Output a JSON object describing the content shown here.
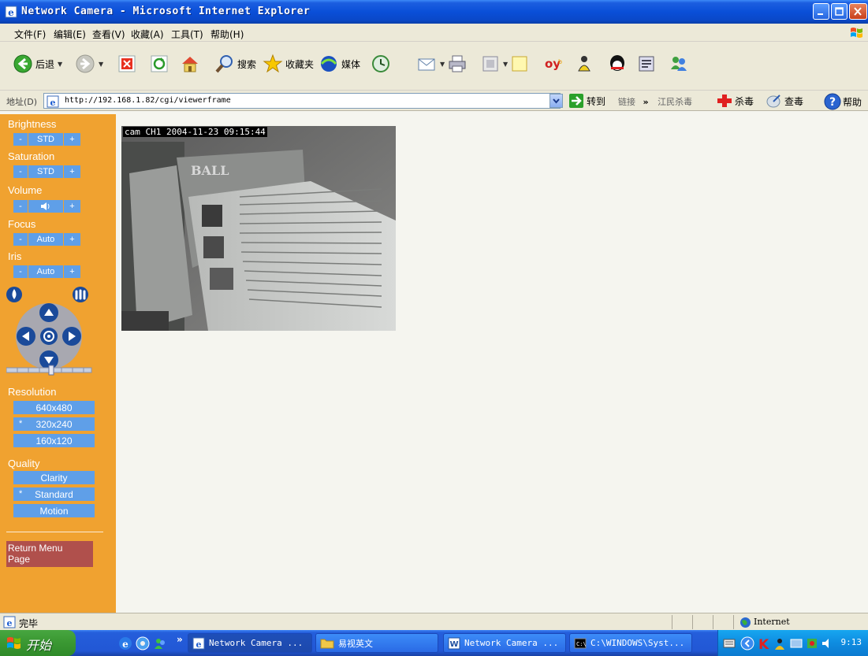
{
  "window": {
    "title": "Network Camera - Microsoft Internet Explorer",
    "colors": {
      "titlebar": "#0a4fd8",
      "panel": "#f0a230",
      "control": "#5f9fe8",
      "return_button": "#b0504c"
    }
  },
  "menu": {
    "items": [
      "文件(F)",
      "编辑(E)",
      "查看(V)",
      "收藏(A)",
      "工具(T)",
      "帮助(H)"
    ]
  },
  "toolbar": {
    "back_label": "后退",
    "search_label": "搜索",
    "favorites_label": "收藏夹",
    "media_label": "媒体"
  },
  "address": {
    "label": "地址(D)",
    "url": "http://192.168.1.82/cgi/viewerframe",
    "go_label": "转到",
    "links_label": "链接",
    "links_extra": "江民杀毒",
    "antivirus_label": "杀毒",
    "scan_label": "查毒",
    "help_label": "帮助"
  },
  "panel": {
    "brightness": {
      "label": "Brightness",
      "minus": "-",
      "value": "STD",
      "plus": "+"
    },
    "saturation": {
      "label": "Saturation",
      "minus": "-",
      "value": "STD",
      "plus": "+"
    },
    "volume": {
      "label": "Volume",
      "minus": "-",
      "value": "🔈",
      "plus": "+"
    },
    "focus": {
      "label": "Focus",
      "minus": "-",
      "value": "Auto",
      "plus": "+"
    },
    "iris": {
      "label": "Iris",
      "minus": "-",
      "value": "Auto",
      "plus": "+"
    },
    "resolution": {
      "label": "Resolution",
      "options": [
        {
          "label": "640x480",
          "selected": false
        },
        {
          "label": "320x240",
          "selected": true
        },
        {
          "label": "160x120",
          "selected": false
        }
      ]
    },
    "quality": {
      "label": "Quality",
      "options": [
        {
          "label": "Clarity",
          "selected": false
        },
        {
          "label": "Standard",
          "selected": true
        },
        {
          "label": "Motion",
          "selected": false
        }
      ]
    },
    "selected_marker": "*",
    "return_line1": "Return Menu",
    "return_line2": "Page"
  },
  "camera": {
    "osd": "cam CH1 2004-11-23 09:15:44"
  },
  "status": {
    "text": "完毕",
    "zone": "Internet"
  },
  "taskbar": {
    "start_label": "开始",
    "tasks": [
      {
        "label": "Network Camera ...",
        "active": true
      },
      {
        "label": "易视英文",
        "active": false
      },
      {
        "label": "Network Camera ...",
        "active": false
      },
      {
        "label": "C:\\WINDOWS\\Syst...",
        "active": false
      }
    ],
    "clock": "9:13"
  }
}
